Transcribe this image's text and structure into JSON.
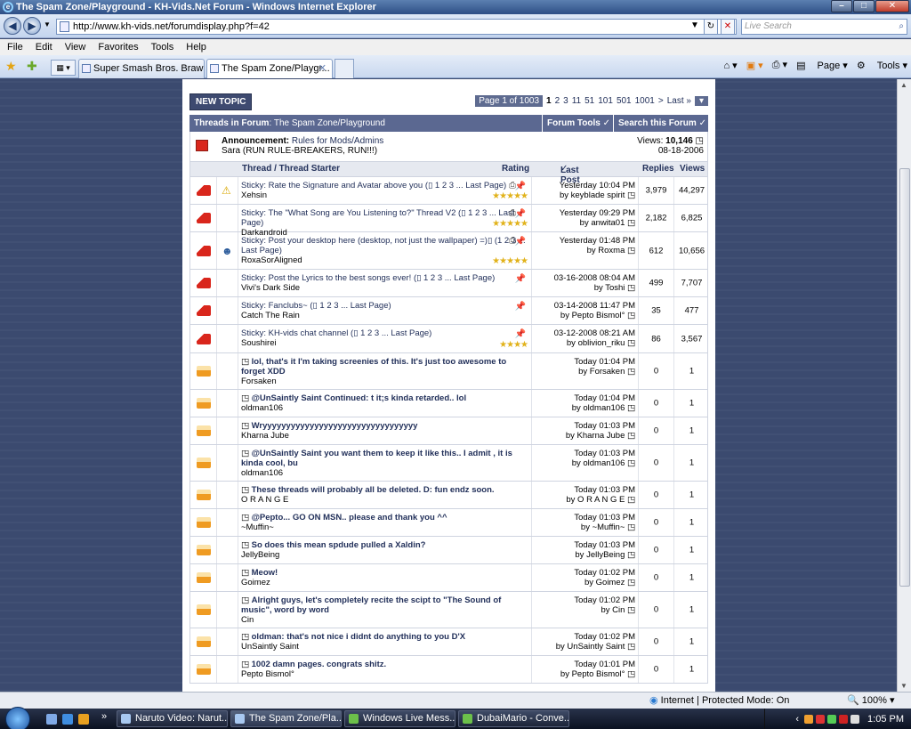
{
  "window": {
    "title": "The Spam Zone/Playground - KH-Vids.Net Forum - Windows Internet Explorer"
  },
  "address": {
    "url": "http://www.kh-vids.net/forumdisplay.php?f=42",
    "search_placeholder": "Live Search"
  },
  "menu": [
    "File",
    "Edit",
    "View",
    "Favorites",
    "Tools",
    "Help"
  ],
  "tabs": [
    {
      "label": "Super Smash Bros. Brawl f..."
    },
    {
      "label": "The Spam Zone/Playgr..."
    }
  ],
  "commands": {
    "page": "Page",
    "tools": "Tools"
  },
  "forum": {
    "new_topic": "NEW TOPIC",
    "pager": {
      "info": "Page 1 of 1003",
      "pages": [
        "1",
        "2",
        "3",
        "11",
        "51",
        "101",
        "501",
        "1001",
        ">",
        "Last »"
      ]
    },
    "header": {
      "threads_label": "Threads in Forum",
      "forum_name": ": The Spam Zone/Playground",
      "forum_tools": "Forum Tools",
      "search": "Search this Forum"
    },
    "announcement": {
      "label": "Announcement:",
      "title": "Rules for Mods/Admins",
      "poster": "Sara (RUN RULE-BREAKERS, RUN!!!)",
      "views_label": "Views:",
      "views": "10,146",
      "date": "08-18-2006"
    },
    "columns": {
      "thread": "Thread / Thread Starter",
      "rating": "Rating",
      "last_post": "Last Post",
      "replies": "Replies",
      "views": "Views"
    },
    "threads": [
      {
        "title": "Sticky: Rate the Signature and Avatar above you (",
        "pages": "1 2 3 ... Last Page)",
        "starter": "Xehsin",
        "last_time": "Yesterday 10:04 PM",
        "last_by": "by keyblade spirit",
        "replies": "3,979",
        "views": "44,297"
      },
      {
        "title": "Sticky: The \"What Song are You Listening to?\" Thread V2 (",
        "pages": "1 2 3 ... Last Page)",
        "starter": "Darkandroid",
        "last_time": "Yesterday 09:29 PM",
        "last_by": "by anwita01",
        "replies": "2,182",
        "views": "6,825"
      },
      {
        "title": "Sticky: Post your desktop here (desktop, not just the wallpaper) =)",
        "pages": "(1 2 3 ... Last Page)",
        "starter": "RoxaSorAligned",
        "last_time": "Yesterday 01:48 PM",
        "last_by": "by Roxma",
        "replies": "612",
        "views": "10,656"
      },
      {
        "title": "Sticky: Post the Lyrics to the best songs ever! (",
        "pages": "1 2 3 ... Last Page)",
        "starter": "Vivi's Dark Side",
        "last_time": "03-16-2008 08:04 AM",
        "last_by": "by Toshi",
        "replies": "499",
        "views": "7,707"
      },
      {
        "title": "Sticky: Fanclubs~ (",
        "pages": "1 2 3 ... Last Page)",
        "starter": "Catch The Rain",
        "last_time": "03-14-2008 11:47 PM",
        "last_by": "by Pepto Bismol°",
        "replies": "35",
        "views": "477"
      },
      {
        "title": "Sticky: KH-vids chat channel (",
        "pages": "1 2 3 ... Last Page)",
        "starter": "Soushirei",
        "last_time": "03-12-2008 08:21 AM",
        "last_by": "by oblivion_riku",
        "replies": "86",
        "views": "3,567"
      },
      {
        "title": "lol, that's it I'm taking screenies of this. It's just too awesome to forget XDD",
        "starter": "Forsaken",
        "last_time": "Today 01:04 PM",
        "last_by": "by Forsaken",
        "replies": "0",
        "views": "1"
      },
      {
        "title": "@UnSaintly Saint Continued: t it;s kinda retarded.. lol",
        "starter": "oldman106",
        "last_time": "Today 01:04 PM",
        "last_by": "by oldman106",
        "replies": "0",
        "views": "1"
      },
      {
        "title": "Wryyyyyyyyyyyyyyyyyyyyyyyyyyyyyyyyy",
        "starter": "Kharna Jube",
        "last_time": "Today 01:03 PM",
        "last_by": "by Kharna Jube",
        "replies": "0",
        "views": "1"
      },
      {
        "title": "@UnSaintly Saint you want them to keep it like this.. I admit , it is kinda cool, bu",
        "starter": "oldman106",
        "last_time": "Today 01:03 PM",
        "last_by": "by oldman106",
        "replies": "0",
        "views": "1"
      },
      {
        "title": "These threads will probably all be deleted. D: fun endz soon.",
        "starter": "O R A N G E",
        "last_time": "Today 01:03 PM",
        "last_by": "by O R A N G E",
        "replies": "0",
        "views": "1"
      },
      {
        "title": "@Pepto... GO ON MSN.. please and thank you ^^",
        "starter": "~Muffin~",
        "last_time": "Today 01:03 PM",
        "last_by": "by ~Muffin~",
        "replies": "0",
        "views": "1"
      },
      {
        "title": "So does this mean spdude pulled a Xaldin?",
        "starter": "JellyBeing",
        "last_time": "Today 01:03 PM",
        "last_by": "by JellyBeing",
        "replies": "0",
        "views": "1"
      },
      {
        "title": "Meow!",
        "starter": "Goimez",
        "last_time": "Today 01:02 PM",
        "last_by": "by Goimez",
        "replies": "0",
        "views": "1"
      },
      {
        "title": "Alright guys, let's completely recite the scipt to \"The Sound of music\", word by word",
        "starter": "Cin",
        "last_time": "Today 01:02 PM",
        "last_by": "by Cin",
        "replies": "0",
        "views": "1"
      },
      {
        "title": "oldman: that's not nice i didnt do anything to you D'X",
        "starter": "UnSaintly Saint",
        "last_time": "Today 01:02 PM",
        "last_by": "by UnSaintly Saint",
        "replies": "0",
        "views": "1"
      },
      {
        "title": "1002 damn pages. congrats shitz.",
        "starter": "Pepto Bismol°",
        "last_time": "Today 01:01 PM",
        "last_by": "by Pepto Bismol°",
        "replies": "0",
        "views": "1"
      }
    ]
  },
  "status": {
    "zone": "Internet | Protected Mode: On",
    "zoom": "100%"
  },
  "taskbar": {
    "tasks": [
      "Naruto Video: Narut...",
      "The Spam Zone/Pla...",
      "Windows Live Mess...",
      "DubaiMario - Conve..."
    ],
    "clock": "1:05 PM"
  }
}
